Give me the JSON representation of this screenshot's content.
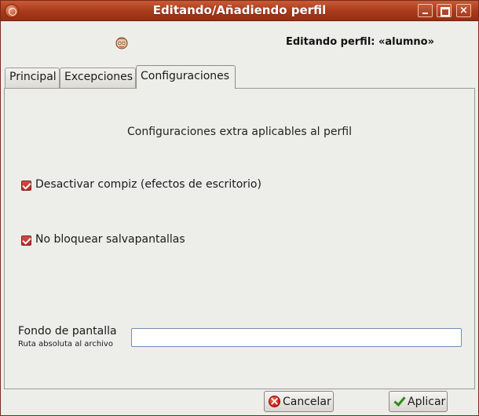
{
  "window": {
    "title": "Editando/Añadiendo perfil"
  },
  "header": {
    "title": "Editando perfil: «alumno»",
    "icon": "user-face-icon"
  },
  "tabs": [
    {
      "label": "Principal",
      "active": false
    },
    {
      "label": "Excepciones",
      "active": false
    },
    {
      "label": "Configuraciones",
      "active": true
    }
  ],
  "panel": {
    "heading": "Configuraciones extra aplicables al perfil",
    "checks": [
      {
        "label": "Desactivar compiz (efectos de escritorio)",
        "checked": true
      },
      {
        "label": "No bloquear salvapantallas",
        "checked": true
      }
    ],
    "wallpaper": {
      "label": "Fondo de pantalla",
      "sublabel": "Ruta absoluta al archivo",
      "value": "",
      "placeholder": ""
    }
  },
  "buttons": {
    "cancel": "Cancelar",
    "apply": "Aplicar"
  },
  "colors": {
    "titlebar": "#a8391b",
    "check": "#c0302b",
    "input_border": "#6f8fb6"
  }
}
